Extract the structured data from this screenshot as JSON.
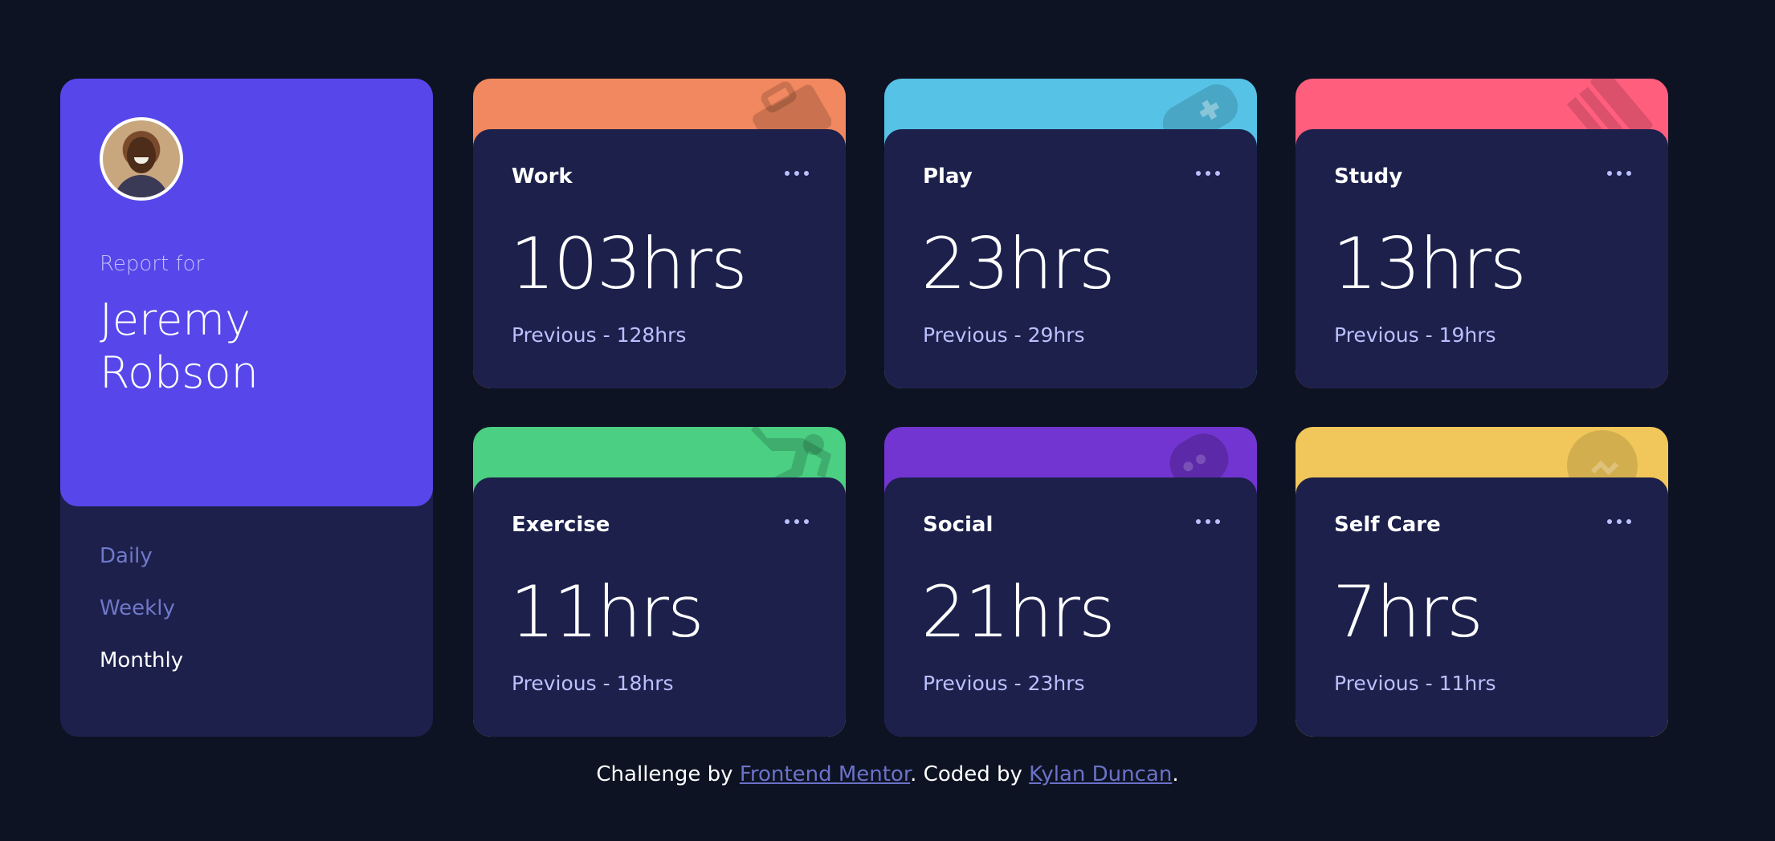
{
  "profile": {
    "report_for": "Report for",
    "name": "Jeremy Robson",
    "periods": [
      {
        "label": "Daily",
        "active": false
      },
      {
        "label": "Weekly",
        "active": false
      },
      {
        "label": "Monthly",
        "active": true
      }
    ]
  },
  "cards": [
    {
      "title": "Work",
      "current": "103hrs",
      "previous": "Previous - 128hrs",
      "color": "#f1885f",
      "icon": "briefcase-icon"
    },
    {
      "title": "Play",
      "current": "23hrs",
      "previous": "Previous - 29hrs",
      "color": "#56c2e6",
      "icon": "gamepad-icon"
    },
    {
      "title": "Study",
      "current": "13hrs",
      "previous": "Previous - 19hrs",
      "color": "#ff5e7d",
      "icon": "book-icon"
    },
    {
      "title": "Exercise",
      "current": "11hrs",
      "previous": "Previous - 18hrs",
      "color": "#4bcf82",
      "icon": "running-icon"
    },
    {
      "title": "Social",
      "current": "21hrs",
      "previous": "Previous - 23hrs",
      "color": "#7335d2",
      "icon": "chat-bubble-icon"
    },
    {
      "title": "Self Care",
      "current": "7hrs",
      "previous": "Previous - 11hrs",
      "color": "#f1c75b",
      "icon": "heart-icon"
    }
  ],
  "footer": {
    "prefix": "Challenge by ",
    "link1": "Frontend Mentor",
    "middle": ". Coded by ",
    "link2": "Kylan Duncan",
    "suffix": "."
  }
}
